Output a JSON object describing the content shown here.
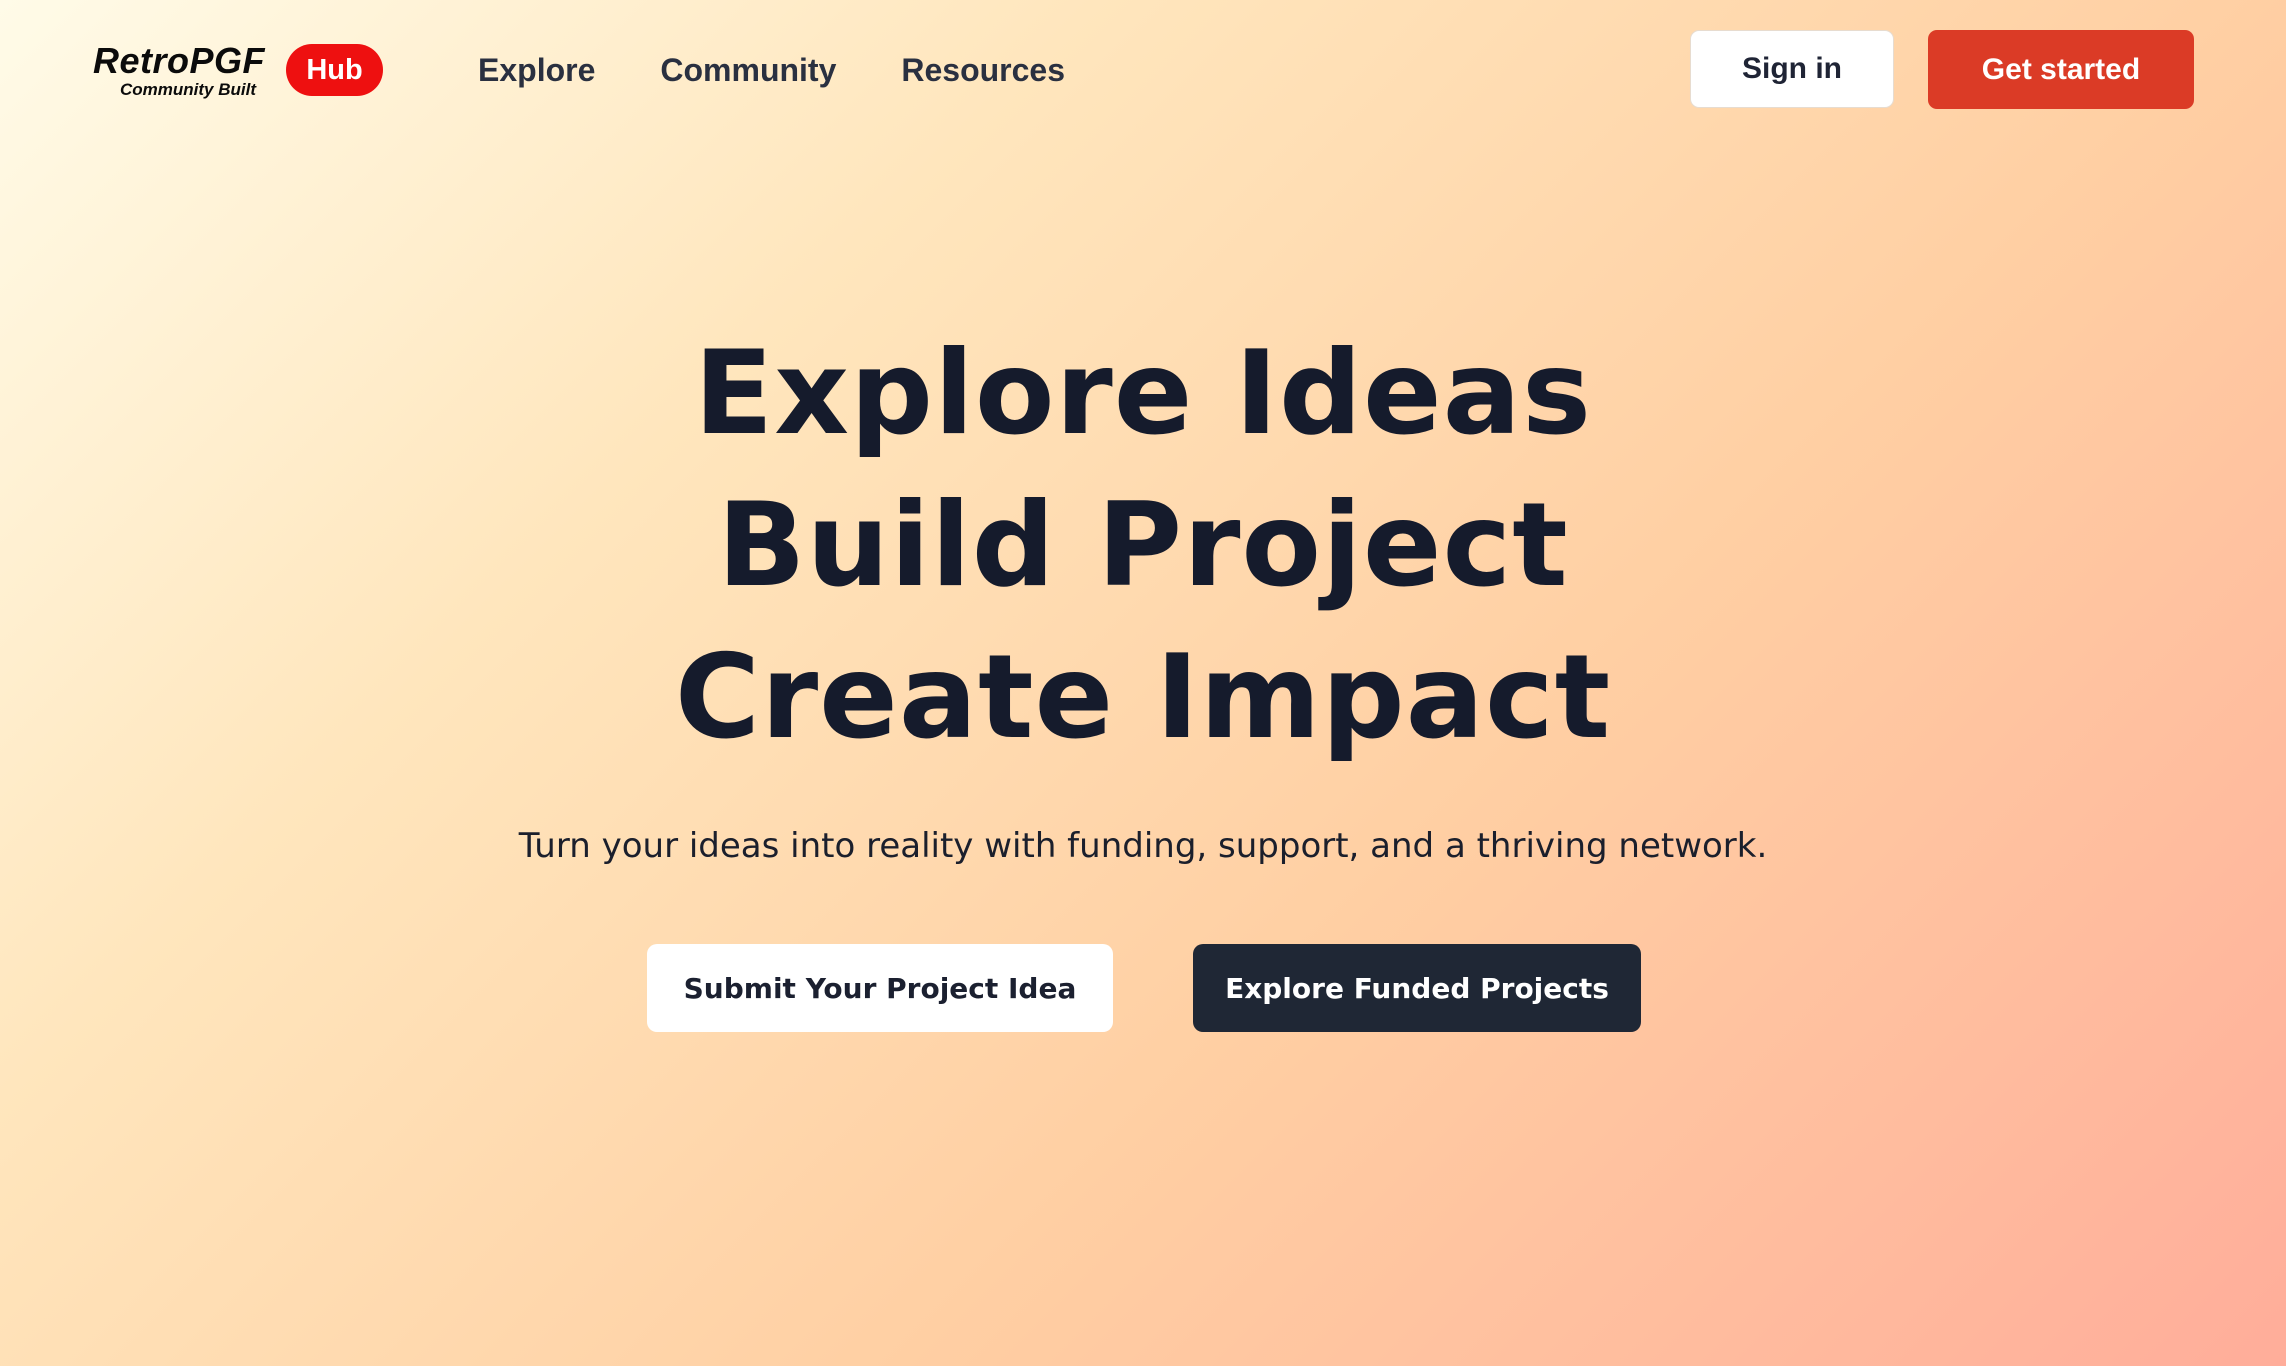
{
  "logo": {
    "name": "RetroPGF",
    "tagline": "Community Built",
    "badge": "Hub"
  },
  "nav": {
    "items": [
      {
        "label": "Explore"
      },
      {
        "label": "Community"
      },
      {
        "label": "Resources"
      }
    ]
  },
  "header_actions": {
    "sign_in": "Sign in",
    "get_started": "Get started"
  },
  "hero": {
    "title_lines": [
      "Explore Ideas",
      "Build Project",
      "Create Impact"
    ],
    "subtitle": "Turn your ideas into reality with funding, support, and a thriving network.",
    "primary_cta": "Submit Your Project Idea",
    "secondary_cta": "Explore Funded Projects"
  },
  "colors": {
    "hub_badge": "#ee1010",
    "get_started_button": "#db3b26",
    "dark_button": "#1f2735",
    "text_primary": "#151b2c"
  }
}
